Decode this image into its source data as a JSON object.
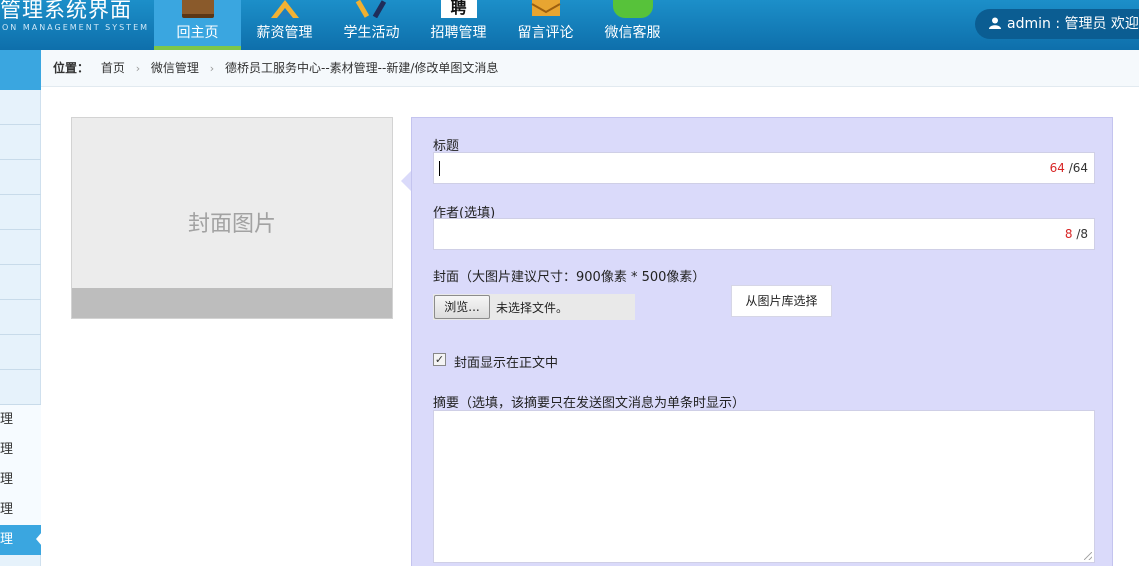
{
  "header": {
    "logo_title": "管理系统界面",
    "logo_subtitle": "ON MANAGEMENT SYSTEM GUI",
    "nav": [
      {
        "label": "回主页",
        "icon": "book-icon",
        "active": true
      },
      {
        "label": "薪资管理",
        "icon": "ruler-icon",
        "active": false
      },
      {
        "label": "学生活动",
        "icon": "pencil-icon",
        "active": false
      },
      {
        "label": "招聘管理",
        "icon": "recruit-icon",
        "active": false
      },
      {
        "label": "留言评论",
        "icon": "mail-icon",
        "active": false
      },
      {
        "label": "微信客服",
        "icon": "wechat-icon",
        "active": false
      }
    ],
    "recruit_icon_glyph": "聘",
    "user_text": "admin : 管理员  欢迎"
  },
  "sidebar": {
    "sub_items": [
      "理",
      "理",
      "理",
      "理",
      "理"
    ],
    "active_index": 4
  },
  "breadcrumb": {
    "label": "位置：",
    "items": [
      "首页",
      "微信管理",
      "德桥员工服务中心--素材管理--新建/修改单图文消息"
    ],
    "separator": "›"
  },
  "cover": {
    "placeholder": "封面图片"
  },
  "form": {
    "title_label": "标题",
    "title_count": "64",
    "title_max": "/64",
    "author_label": "作者(选填)",
    "author_count": "8",
    "author_max": "/8",
    "cover_label": "封面（大图片建议尺寸：900像素 * 500像素）",
    "browse_label": "浏览...",
    "no_file_text": "未选择文件。",
    "library_button": "从图片库选择",
    "show_cover_checked": true,
    "checkbox_mark": "✓",
    "show_cover_label": "封面显示在正文中",
    "summary_label": "摘要（选填，该摘要只在发送图文消息为单条时显示）"
  },
  "colors": {
    "header_bg": "#0e6fab",
    "active_tab": "#3aa6e0",
    "active_underline": "#7cc64a",
    "panel_bg": "#dadafa",
    "counter_red": "#d82626"
  }
}
